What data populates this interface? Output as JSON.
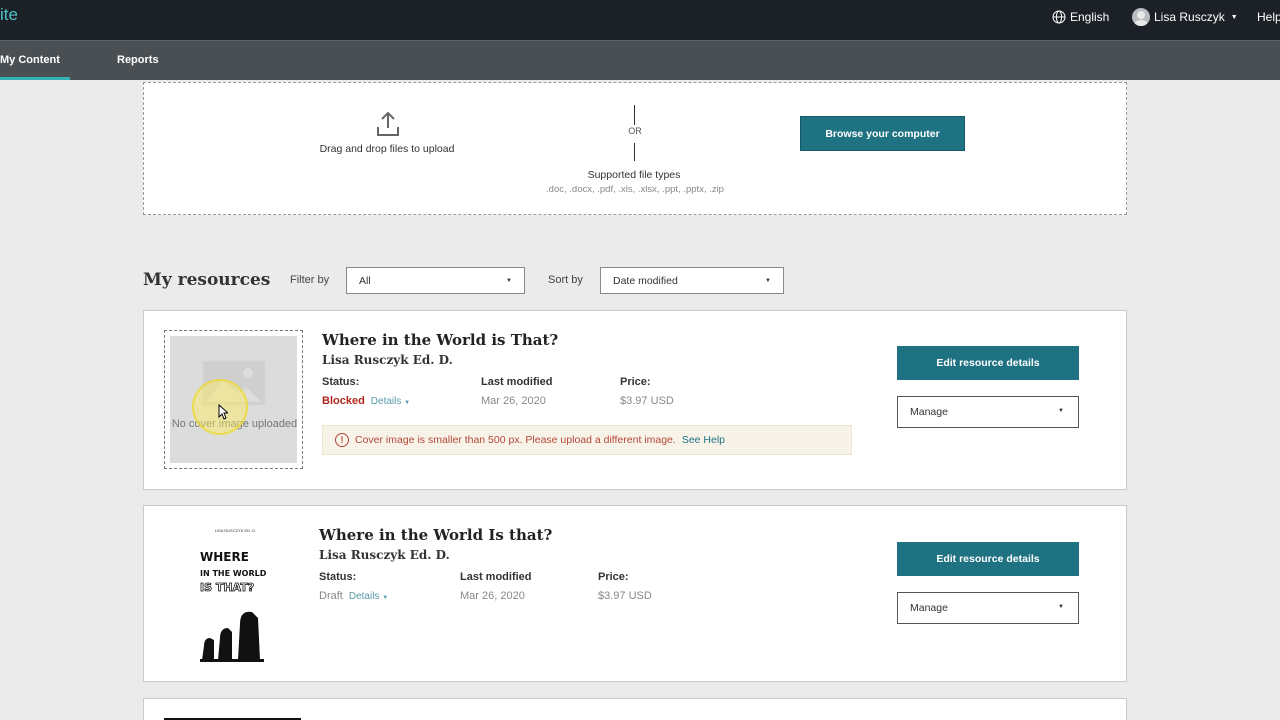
{
  "header": {
    "brand": "ite",
    "language": "English",
    "user_name": "Lisa Rusczyk",
    "help": "Help"
  },
  "nav": {
    "tabs": [
      {
        "label": "My Content",
        "active": true
      },
      {
        "label": "Reports",
        "active": false
      }
    ]
  },
  "upload": {
    "drag_text": "Drag and drop files to upload",
    "or": "OR",
    "supported_title": "Supported file types",
    "supported_types": ".doc, .docx, .pdf, .xls, .xlsx, .ppt, .pptx, .zip",
    "browse_label": "Browse your computer"
  },
  "resources": {
    "heading": "My resources",
    "filter_label": "Filter by",
    "filter_value": "All",
    "sort_label": "Sort by",
    "sort_value": "Date modified",
    "items": [
      {
        "title": "Where in the World is That?",
        "author": "Lisa Rusczyk Ed. D.",
        "status_label": "Status:",
        "status": "Blocked",
        "details": "Details",
        "modified_label": "Last modified",
        "modified": "Mar 26, 2020",
        "price_label": "Price:",
        "price": "$3.97 USD",
        "cover_text": "No cover image uploaded",
        "warning": "Cover image is smaller than 500 px. Please upload a different image.",
        "warning_link": "See Help",
        "edit_label": "Edit resource details",
        "manage_label": "Manage"
      },
      {
        "title": "Where in the World Is that?",
        "author": "Lisa Rusczyk Ed. D.",
        "status_label": "Status:",
        "status": "Draft",
        "details": "Details",
        "modified_label": "Last modified",
        "modified": "Mar 26, 2020",
        "price_label": "Price:",
        "price": "$3.97 USD",
        "cover": {
          "author": "LISA RUSCZYK ED. D.",
          "line1": "WHERE",
          "line2": "IN THE WORLD",
          "line3": "IS THAT?"
        },
        "edit_label": "Edit resource details",
        "manage_label": "Manage"
      }
    ]
  },
  "colors": {
    "topbar": "#1b2126",
    "navbar": "#4a4f53",
    "accent": "#1f7282",
    "blocked": "#b3261e"
  }
}
